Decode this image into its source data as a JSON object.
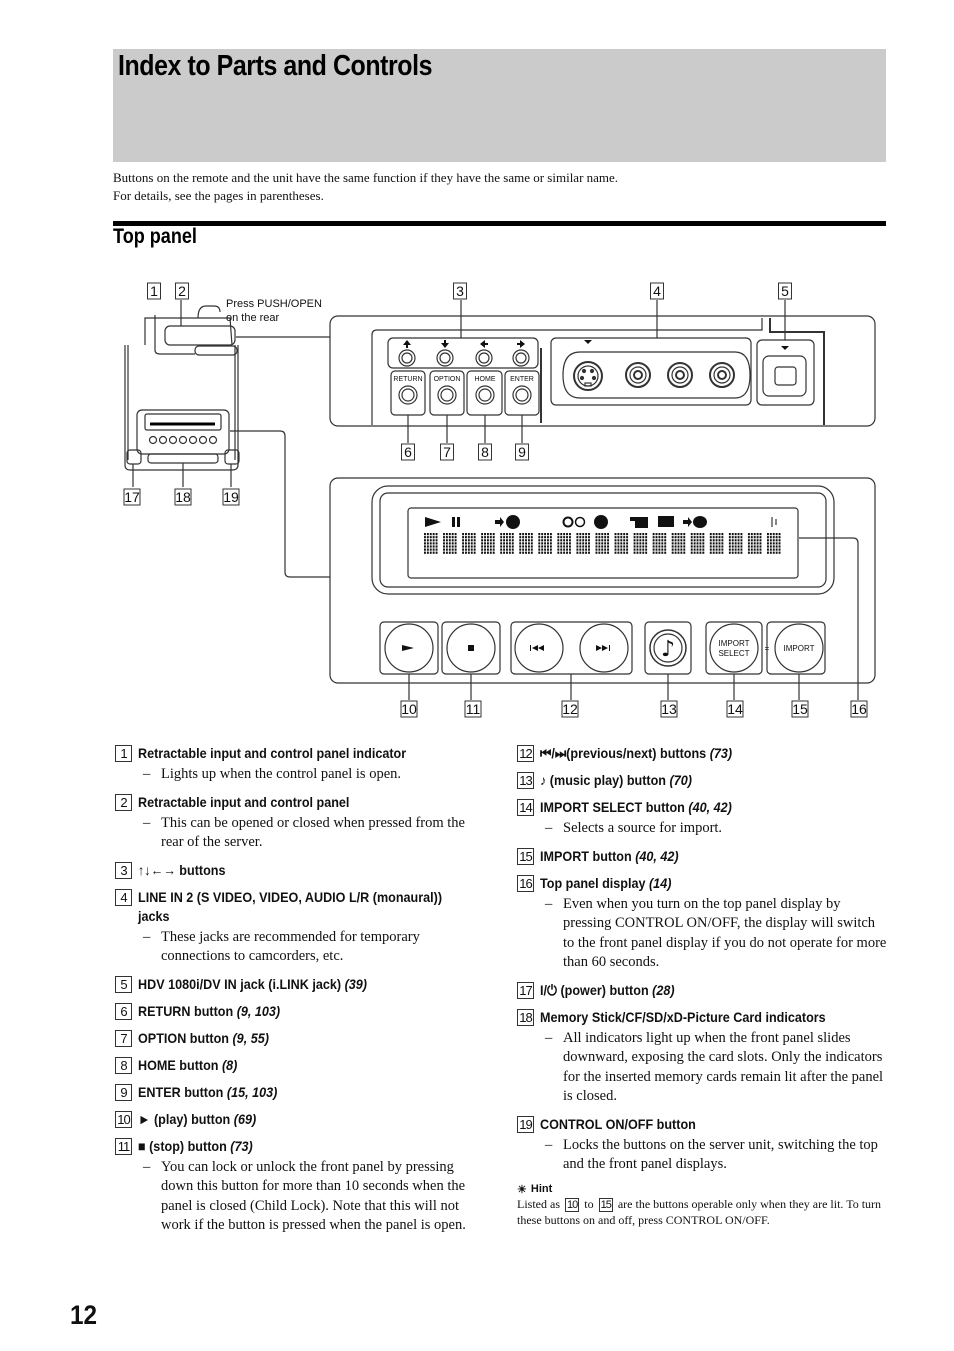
{
  "page": {
    "title": "Index to Parts and Controls",
    "intro_line1": "Buttons on the remote and the unit have the same function if they have the same or similar name.",
    "intro_line2": "For details, see the pages in parentheses.",
    "section_title": "Top panel",
    "page_number": "12"
  },
  "diagram": {
    "callout_note_line1": "Press PUSH/OPEN",
    "callout_note_line2": "on the rear",
    "callouts": [
      "1",
      "2",
      "3",
      "4",
      "5",
      "6",
      "7",
      "8",
      "9",
      "10",
      "11",
      "12",
      "13",
      "14",
      "15",
      "16",
      "17",
      "18",
      "19"
    ],
    "button_labels": {
      "return": "RETURN",
      "option": "OPTION",
      "home": "HOME",
      "enter": "ENTER",
      "import_select_line1": "IMPORT",
      "import_select_line2": "SELECT",
      "import": "IMPORT",
      "equals": "="
    },
    "display_cells": 19
  },
  "items_left": [
    {
      "n": "1",
      "title": "Retractable input and control panel indicator",
      "pages": "",
      "desc": [
        "Lights up when the control panel is open."
      ]
    },
    {
      "n": "2",
      "title": "Retractable input and control panel",
      "pages": "",
      "desc": [
        "This can be opened or closed when pressed from the rear of the server."
      ]
    },
    {
      "n": "3",
      "title": "↑↓←→ buttons",
      "pages": "",
      "desc": []
    },
    {
      "n": "4",
      "title": "LINE IN 2 (S VIDEO, VIDEO, AUDIO L/R (monaural)) jacks",
      "pages": "",
      "desc": [
        "These jacks are recommended for temporary connections to camcorders, etc."
      ]
    },
    {
      "n": "5",
      "title": "HDV 1080i/DV IN jack (i.LINK jack)",
      "pages": "(39)",
      "desc": []
    },
    {
      "n": "6",
      "title": "RETURN button",
      "pages": "(9, 103)",
      "desc": []
    },
    {
      "n": "7",
      "title": "OPTION button",
      "pages": "(9, 55)",
      "desc": []
    },
    {
      "n": "8",
      "title": "HOME button",
      "pages": "(8)",
      "desc": []
    },
    {
      "n": "9",
      "title": "ENTER button",
      "pages": "(15, 103)",
      "desc": []
    },
    {
      "n": "10",
      "title": "► (play) button",
      "pages": "(69)",
      "desc": []
    },
    {
      "n": "11",
      "title": "■ (stop) button",
      "pages": "(73)",
      "desc": [
        "You can lock or unlock the front panel by pressing down this button for more than 10 seconds when the panel is closed (Child Lock). Note that this will not work if the button is pressed when the panel is open."
      ]
    }
  ],
  "items_right": [
    {
      "n": "12",
      "title": "⏮/⏭(previous/next) buttons",
      "pages": "(73)",
      "desc": []
    },
    {
      "n": "13",
      "title": "♪ (music play) button",
      "pages": "(70)",
      "desc": []
    },
    {
      "n": "14",
      "title": "IMPORT SELECT button",
      "pages": "(40, 42)",
      "desc": [
        "Selects a source for import."
      ]
    },
    {
      "n": "15",
      "title": "IMPORT button",
      "pages": "(40, 42)",
      "desc": []
    },
    {
      "n": "16",
      "title": "Top panel display",
      "pages": "(14)",
      "desc": [
        "Even when you turn on the top panel display by pressing CONTROL ON/OFF, the display will switch to the front panel display if you do not operate for more than 60 seconds."
      ]
    },
    {
      "n": "17",
      "title": "I/⏻ (power) button",
      "pages": "(28)",
      "desc": []
    },
    {
      "n": "18",
      "title": "Memory Stick/CF/SD/xD-Picture Card indicators",
      "pages": "",
      "desc": [
        "All indicators light up when the front panel slides downward, exposing the card slots. Only the indicators for the inserted memory cards remain lit after the panel is closed."
      ]
    },
    {
      "n": "19",
      "title": "CONTROL ON/OFF button",
      "pages": "",
      "desc": [
        "Locks the buttons on the server unit, switching the top and the front panel displays."
      ]
    }
  ],
  "hint": {
    "title": "Hint",
    "text_before": "Listed as",
    "from": "10",
    "mid": "to",
    "to": "15",
    "text_after": "are the buttons operable only when they are lit. To turn these buttons on and off, press CONTROL ON/OFF."
  }
}
